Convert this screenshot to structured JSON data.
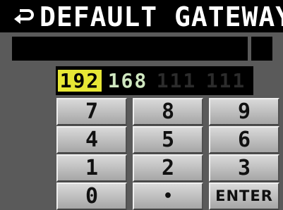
{
  "header": {
    "title": "DEFAULT GATEWAY",
    "back_icon": "return-arrow-icon"
  },
  "ip": {
    "octets": [
      "192",
      "168",
      "111",
      "111"
    ]
  },
  "keypad": {
    "keys": [
      "7",
      "8",
      "9",
      "4",
      "5",
      "6",
      "1",
      "2",
      "3",
      "0",
      "•",
      "ENTER"
    ]
  },
  "colors": {
    "active_octet": "#e7e735",
    "edited_octet": "#cfe7c0",
    "inactive_octet": "#2c2c2c",
    "background": "#5a5a5a"
  }
}
